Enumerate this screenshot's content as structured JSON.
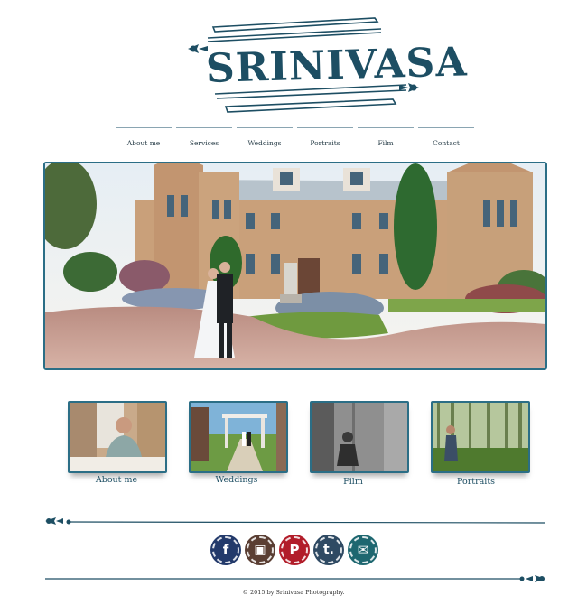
{
  "brand": {
    "name": "SRINIVASA"
  },
  "nav": {
    "items": [
      {
        "label": "About me"
      },
      {
        "label": "Services"
      },
      {
        "label": "Weddings"
      },
      {
        "label": "Portraits"
      },
      {
        "label": "Film"
      },
      {
        "label": "Contact"
      }
    ]
  },
  "gallery": {
    "items": [
      {
        "label": "About me"
      },
      {
        "label": "Weddings"
      },
      {
        "label": "Film"
      },
      {
        "label": "Portraits"
      }
    ]
  },
  "social": {
    "items": [
      {
        "icon": "facebook-icon",
        "glyph": "f",
        "color": "#233a6b"
      },
      {
        "icon": "instagram-icon",
        "glyph": "▣",
        "color": "#5a3e33"
      },
      {
        "icon": "pinterest-icon",
        "glyph": "P",
        "color": "#b21d2a"
      },
      {
        "icon": "tumblr-icon",
        "glyph": "t.",
        "color": "#2f4a63"
      },
      {
        "icon": "email-icon",
        "glyph": "✉",
        "color": "#1e6770"
      }
    ]
  },
  "footer": {
    "copyright": "© 2015 by Srinivasa Photography."
  },
  "colors": {
    "accent": "#1d4e63",
    "border": "#2b6e86"
  }
}
